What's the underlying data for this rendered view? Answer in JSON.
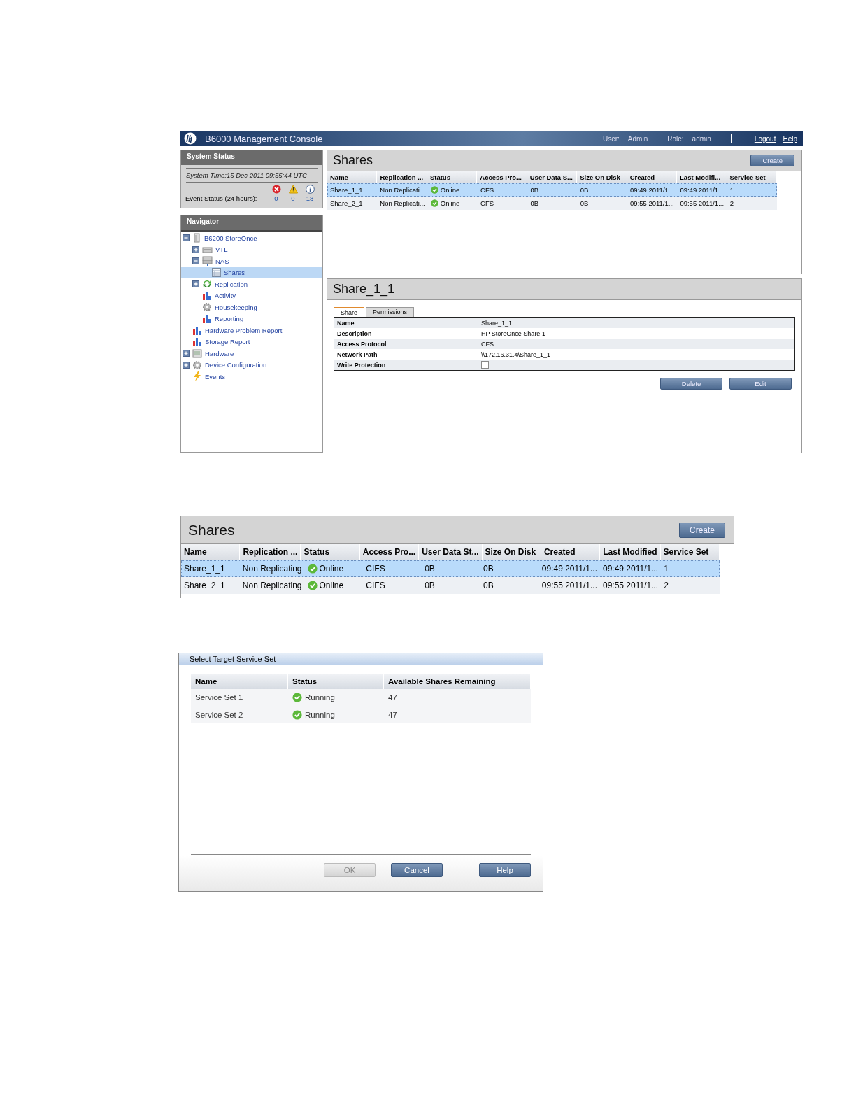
{
  "console": {
    "title": "B6000 Management Console",
    "user_label": "User:",
    "user": "Admin",
    "role_label": "Role:",
    "role": "admin",
    "links": [
      "Logout",
      "Help"
    ],
    "system_status": {
      "title": "System Status",
      "time": "System Time:15 Dec 2011 09:55:44 UTC",
      "event_label": "Event Status (24 hours):",
      "counts": [
        {
          "kind": "error",
          "value": "0"
        },
        {
          "kind": "warning",
          "value": "0"
        },
        {
          "kind": "info",
          "value": "18"
        }
      ]
    },
    "navigator": {
      "title": "Navigator",
      "tree": [
        {
          "label": "B6200 StoreOnce",
          "kind": "system",
          "expanded": true,
          "selected": false,
          "children": [
            {
              "label": "VTL",
              "kind": "library",
              "expanded": false,
              "selected": false
            },
            {
              "label": "NAS",
              "kind": "nas",
              "expanded": true,
              "selected": false,
              "children": [
                {
                  "label": "Shares",
                  "kind": "share",
                  "selected": true
                }
              ]
            },
            {
              "label": "Replication",
              "kind": "replication",
              "expanded": false,
              "selected": false
            },
            {
              "label": "Activity",
              "kind": "report",
              "selected": false
            },
            {
              "label": "Housekeeping",
              "kind": "housekeeping",
              "selected": false
            },
            {
              "label": "Reporting",
              "kind": "report",
              "selected": false
            }
          ]
        },
        {
          "label": "Hardware Problem Report",
          "kind": "report",
          "selected": false
        },
        {
          "label": "Storage Report",
          "kind": "report",
          "selected": false
        },
        {
          "label": "Hardware",
          "kind": "hardware",
          "expanded": false,
          "selected": false
        },
        {
          "label": "Device Configuration",
          "kind": "housekeeping",
          "expanded": false,
          "selected": false
        },
        {
          "label": "Events",
          "kind": "events",
          "selected": false
        }
      ]
    },
    "shares": {
      "title": "Shares",
      "create": "Create",
      "columns": [
        "Name",
        "Replication ...",
        "Status",
        "Access Pro...",
        "User Data S...",
        "Size On Disk",
        "Created",
        "Last Modifi...",
        "Service Set"
      ],
      "rows": [
        {
          "selected": true,
          "cells": [
            "Share_1_1",
            "Non Replicati...",
            {
              "text": "Online",
              "healthy": true
            },
            "CFS",
            "0B",
            "0B",
            "09:49 2011/1...",
            "09:49 2011/1...",
            "1"
          ]
        },
        {
          "selected": false,
          "cells": [
            "Share_2_1",
            "Non Replicati...",
            {
              "text": "Online",
              "healthy": true
            },
            "CFS",
            "0B",
            "0B",
            "09:55 2011/1...",
            "09:55 2011/1...",
            "2"
          ]
        }
      ]
    },
    "detail": {
      "title": "Share_1_1",
      "tabs": [
        {
          "label": "Share",
          "selected": true
        },
        {
          "label": "Permissions",
          "selected": false
        }
      ],
      "properties": [
        {
          "kind": "text",
          "label": "Name",
          "value": "Share_1_1"
        },
        {
          "kind": "text",
          "label": "Description",
          "value": "HP StoreOnce Share 1"
        },
        {
          "kind": "text",
          "label": "Access Protocol",
          "value": "CFS"
        },
        {
          "kind": "text",
          "label": "Network Path",
          "value": "\\\\172.16.31.4\\Share_1_1"
        },
        {
          "kind": "checkbox",
          "label": "Write Protection",
          "checked": false
        }
      ],
      "buttons": [
        "Delete",
        "Edit"
      ]
    }
  },
  "shares_panel": {
    "title": "Shares",
    "create": "Create",
    "columns": [
      "Name",
      "Replication ...",
      "Status",
      "Access Pro...",
      "User Data St...",
      "Size On Disk",
      "Created",
      "Last Modified",
      "Service Set"
    ],
    "rows": [
      {
        "selected": true,
        "cells": [
          "Share_1_1",
          "Non Replicating",
          {
            "text": "Online",
            "healthy": true
          },
          "CIFS",
          "0B",
          "0B",
          "09:49 2011/1...",
          "09:49 2011/1...",
          "1"
        ]
      },
      {
        "selected": false,
        "cells": [
          "Share_2_1",
          "Non Replicating",
          {
            "text": "Online",
            "healthy": true
          },
          "CIFS",
          "0B",
          "0B",
          "09:55 2011/1...",
          "09:55 2011/1...",
          "2"
        ]
      }
    ]
  },
  "dialog": {
    "title": "Select Target Service Set",
    "columns": [
      "Name",
      "Status",
      "Available Shares Remaining"
    ],
    "rows": [
      {
        "cells": [
          "Service Set 1",
          {
            "text": "Running",
            "healthy": true
          },
          "47"
        ]
      },
      {
        "cells": [
          "Service Set 2",
          {
            "text": "Running",
            "healthy": true
          },
          "47"
        ]
      }
    ],
    "buttons": [
      {
        "label": "OK",
        "disabled": true
      },
      {
        "label": "Cancel",
        "disabled": false
      },
      {
        "label": "Help",
        "disabled": false
      }
    ]
  }
}
